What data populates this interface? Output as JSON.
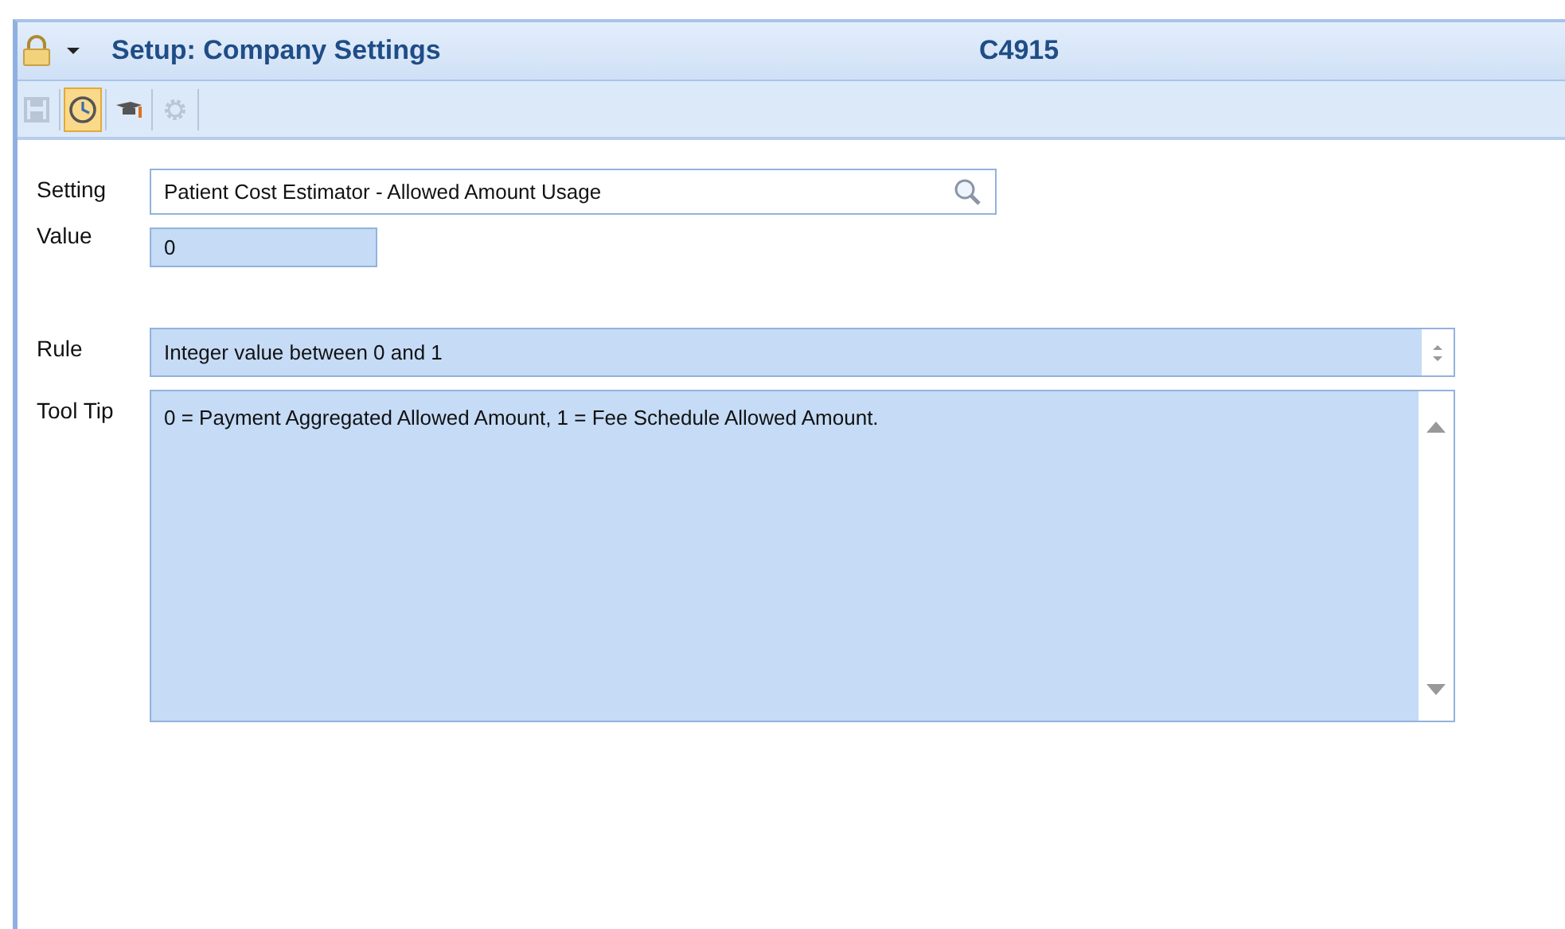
{
  "window": {
    "title": "Setup: Company Settings",
    "record_id": "C4915"
  },
  "toolbar": [
    {
      "kind": "save",
      "disabled": true,
      "selected": false
    },
    {
      "kind": "clock",
      "disabled": false,
      "selected": true
    },
    {
      "kind": "cap",
      "disabled": false,
      "selected": false
    },
    {
      "kind": "gear",
      "disabled": true,
      "selected": false
    }
  ],
  "form": {
    "setting": {
      "label": "Setting",
      "value": "Patient Cost Estimator - Allowed Amount Usage"
    },
    "value": {
      "label": "Value",
      "value": "0"
    },
    "rule": {
      "label": "Rule",
      "value": "Integer value between 0 and 1"
    },
    "tool_tip": {
      "label": "Tool Tip",
      "value": "0 = Payment Aggregated Allowed Amount, 1 = Fee Schedule Allowed Amount."
    }
  }
}
